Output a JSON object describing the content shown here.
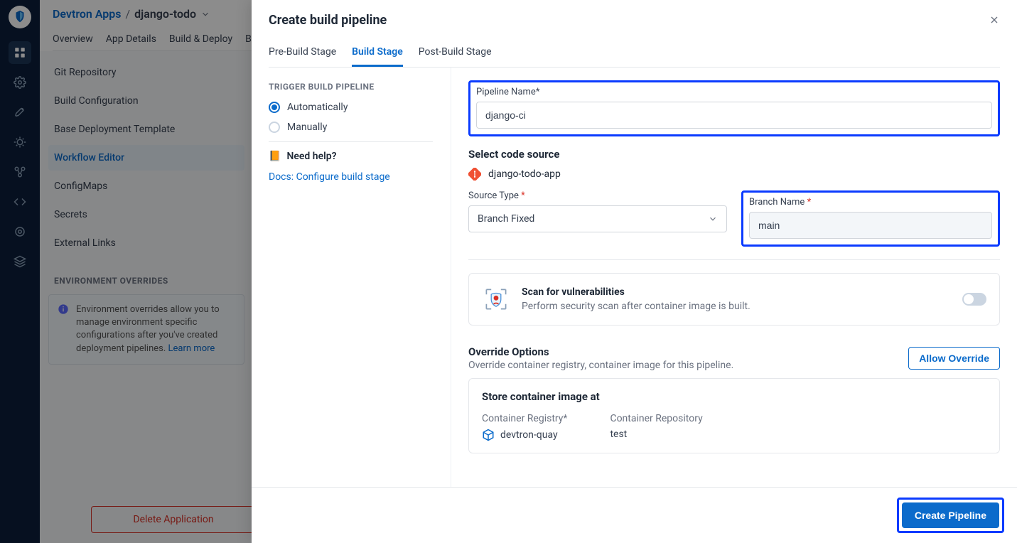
{
  "breadcrumb": {
    "root": "Devtron Apps",
    "app": "django-todo"
  },
  "topTabs": [
    "Overview",
    "App Details",
    "Build & Deploy",
    "B…"
  ],
  "sidebar": {
    "items": [
      "Git Repository",
      "Build Configuration",
      "Base Deployment Template",
      "Workflow Editor",
      "ConfigMaps",
      "Secrets",
      "External Links"
    ],
    "activeIndex": 3,
    "sectionTitle": "ENVIRONMENT OVERRIDES",
    "callout": "Environment overrides allow you to manage environment specific configurations after you've created deployment pipelines.",
    "calloutLink": "Learn more",
    "deleteLabel": "Delete Application"
  },
  "modal": {
    "title": "Create build pipeline",
    "tabs": [
      "Pre-Build Stage",
      "Build Stage",
      "Post-Build Stage"
    ],
    "activeTab": 1,
    "triggerLabel": "TRIGGER BUILD PIPELINE",
    "triggerOptions": {
      "auto": "Automatically",
      "manual": "Manually"
    },
    "helpLabel": "Need help?",
    "docLink": "Docs: Configure build stage",
    "pipelineName": {
      "label": "Pipeline Name*",
      "value": "django-ci"
    },
    "codeSource": {
      "heading": "Select code source",
      "repo": "django-todo-app",
      "sourceType": {
        "label": "Source Type",
        "value": "Branch Fixed"
      },
      "branchName": {
        "label": "Branch Name",
        "value": "main"
      }
    },
    "scan": {
      "title": "Scan for vulnerabilities",
      "desc": "Perform security scan after container image is built."
    },
    "override": {
      "title": "Override Options",
      "desc": "Override container registry, container image for this pipeline.",
      "button": "Allow Override"
    },
    "store": {
      "title": "Store container image at",
      "registryLabel": "Container Registry*",
      "registryValue": "devtron-quay",
      "repoLabel": "Container Repository",
      "repoValue": "test"
    },
    "createButton": "Create Pipeline"
  }
}
